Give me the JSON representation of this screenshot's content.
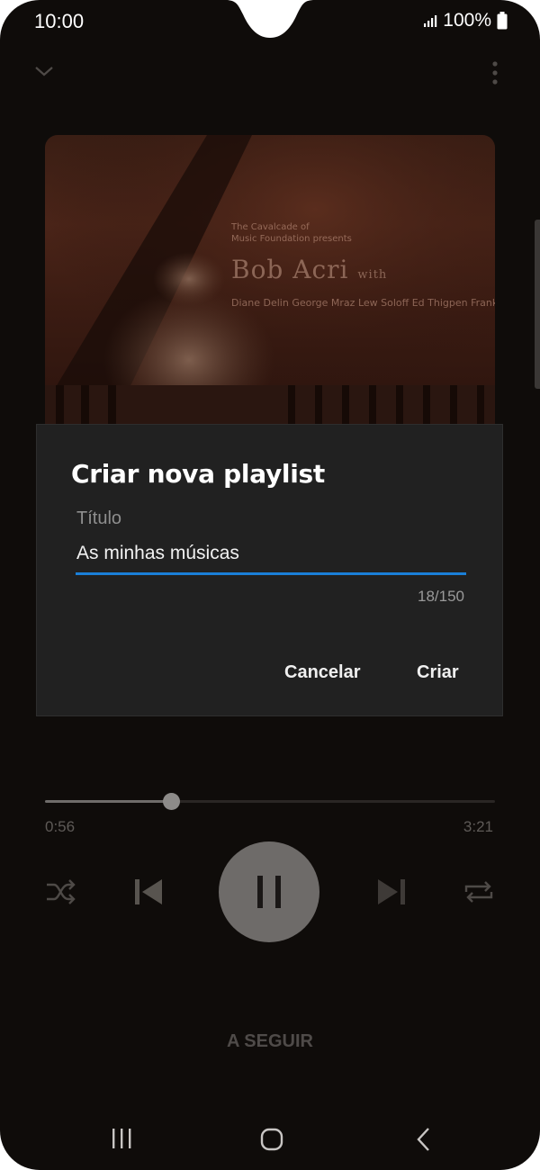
{
  "status_bar": {
    "time": "10:00",
    "battery": "100%",
    "icons": [
      "signal-icon",
      "battery-icon"
    ]
  },
  "top_bar": {
    "icons": [
      "chevron-down-icon",
      "more-vert-icon"
    ]
  },
  "album_art": {
    "presenter": "The Cavalcade of",
    "presenter_line2": "Music Foundation presents",
    "title": "Bob Acri",
    "title_suffix": "with",
    "performers": "Diane Delin  George Mraz  Lew Soloff  Ed Thigpen  Frank Wess"
  },
  "dialog": {
    "title": "Criar nova playlist",
    "field_label": "Título",
    "field_value": "As minhas músicas",
    "counter": "18/150",
    "cancel_label": "Cancelar",
    "create_label": "Criar",
    "accent_color": "#1a7fd8"
  },
  "player": {
    "elapsed": "0:56",
    "duration": "3:21",
    "progress_fraction": 0.279,
    "controls": [
      "shuffle-icon",
      "previous-icon",
      "pause-icon",
      "next-icon",
      "repeat-icon"
    ],
    "up_next_label": "A SEGUIR"
  },
  "nav_bar": {
    "icons": [
      "recents-icon",
      "home-icon",
      "back-icon"
    ]
  }
}
